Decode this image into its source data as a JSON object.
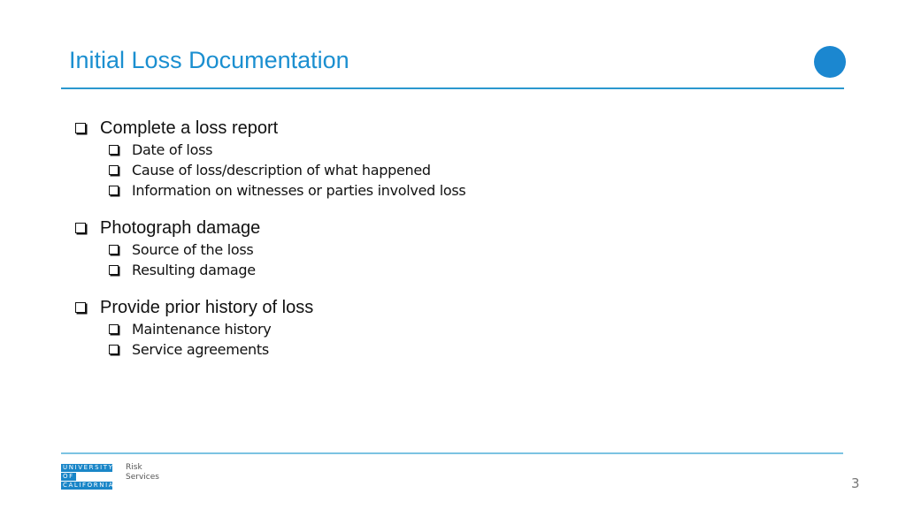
{
  "slide": {
    "title": "Initial Loss Documentation",
    "accent_color": "#1b8fd0",
    "page_number": "3"
  },
  "content": {
    "groups": [
      {
        "label": "Complete a loss report",
        "items": [
          "Date of loss",
          "Cause of loss/description of what happened",
          "Information on witnesses or parties involved loss"
        ]
      },
      {
        "label": "Photograph damage",
        "items": [
          "Source of the loss",
          "Resulting damage"
        ]
      },
      {
        "label": "Provide prior history of loss",
        "items": [
          "Maintenance history",
          "Service agreements"
        ]
      }
    ]
  },
  "footer": {
    "logo_lines": [
      "UNIVERSITY",
      "OF",
      "CALIFORNIA"
    ],
    "department_line1": "Risk",
    "department_line2": "Services"
  }
}
